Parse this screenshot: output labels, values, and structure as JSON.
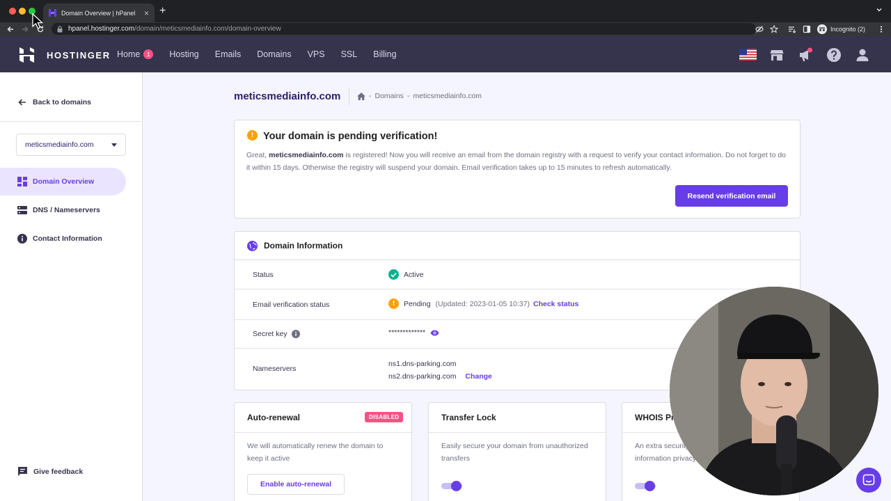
{
  "browser": {
    "tab_title": "Domain Overview | hPanel",
    "url_host": "hpanel.hostinger.com",
    "url_path": "/domain/meticsmediainfo.com/domain-overview",
    "profile_label": "Incognito (2)"
  },
  "header": {
    "brand": "HOSTINGER",
    "nav": [
      {
        "label": "Home",
        "badge": "1"
      },
      {
        "label": "Hosting"
      },
      {
        "label": "Emails"
      },
      {
        "label": "Domains"
      },
      {
        "label": "VPS"
      },
      {
        "label": "SSL"
      },
      {
        "label": "Billing"
      }
    ],
    "icons": [
      "us-flag-icon",
      "store-icon",
      "announcement-icon",
      "help-icon",
      "account-icon"
    ]
  },
  "sidebar": {
    "back_label": "Back to domains",
    "domain_select": "meticsmediainfo.com",
    "items": [
      {
        "label": "Domain Overview",
        "icon": "dashboard-icon",
        "active": true
      },
      {
        "label": "DNS / Nameservers",
        "icon": "server-icon",
        "active": false
      },
      {
        "label": "Contact Information",
        "icon": "info-icon",
        "active": false
      }
    ],
    "feedback_label": "Give feedback"
  },
  "page": {
    "title": "meticsmediainfo.com",
    "breadcrumb": [
      "Domains",
      "meticsmediainfo.com"
    ]
  },
  "verification": {
    "title": "Your domain is pending verification!",
    "text_pre": "Great, ",
    "text_domain": "meticsmediainfo.com",
    "text_post": " is registered! Now you will receive an email from the domain registry with a request to verify your contact information. Do not forget to do it within 15 days. Otherwise the registry will suspend your domain. Email verification takes up to 15 minutes to refresh automatically.",
    "button": "Resend verification email"
  },
  "domain_info": {
    "title": "Domain Information",
    "status_label": "Status",
    "status_value": "Active",
    "email_label": "Email verification status",
    "email_value": "Pending",
    "email_updated": "(Updated: 2023-01-05 10:37)",
    "email_link": "Check status",
    "secret_label": "Secret key",
    "secret_value": "*************",
    "ns_label": "Nameservers",
    "ns1": "ns1.dns-parking.com",
    "ns2": "ns2.dns-parking.com",
    "ns_link": "Change"
  },
  "features": {
    "autorenew": {
      "title": "Auto-renewal",
      "badge": "DISABLED",
      "text": "We will automatically renew the domain to keep it active",
      "button": "Enable auto-renewal"
    },
    "transfer": {
      "title": "Transfer Lock",
      "text": "Easily secure your domain from unauthorized transfers",
      "enabled": true
    },
    "whois": {
      "title": "WHOIS Pri",
      "text_line1": "An extra security",
      "text_line2": "information privacy",
      "enabled": true
    }
  },
  "colors": {
    "primary": "#673de6",
    "header_bg": "#36344d",
    "success": "#00b090",
    "warning": "#ffa103",
    "danger": "#fc5185"
  }
}
